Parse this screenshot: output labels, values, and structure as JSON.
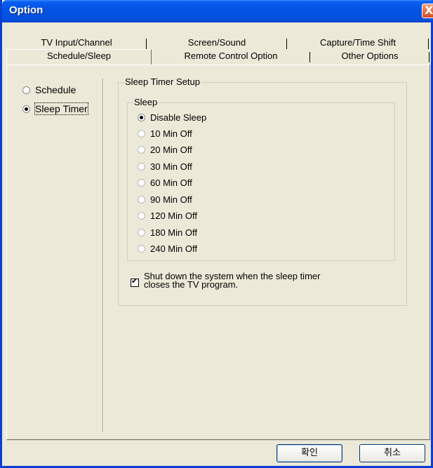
{
  "window": {
    "title": "Option",
    "close_glyph": "X"
  },
  "tabs": {
    "back_row": [
      {
        "label": "TV Input/Channel"
      },
      {
        "label": "Screen/Sound"
      },
      {
        "label": "Capture/Time Shift"
      }
    ],
    "front_row": [
      {
        "label": "Schedule/Sleep",
        "active": true
      },
      {
        "label": "Remote Control Option"
      },
      {
        "label": "Other Options"
      }
    ]
  },
  "nav": {
    "items": [
      {
        "label": "Schedule",
        "checked": false
      },
      {
        "label": "Sleep Timer",
        "checked": true
      }
    ]
  },
  "sleep_timer_setup": {
    "group_title": "Sleep Timer Setup",
    "sleep_group_title": "Sleep",
    "options": [
      {
        "label": "Disable Sleep",
        "checked": true
      },
      {
        "label": "10 Min Off",
        "checked": false
      },
      {
        "label": "20 Min Off",
        "checked": false
      },
      {
        "label": "30 Min Off",
        "checked": false
      },
      {
        "label": "60 Min Off",
        "checked": false
      },
      {
        "label": "90 Min Off",
        "checked": false
      },
      {
        "label": "120 Min Off",
        "checked": false
      },
      {
        "label": "180 Min Off",
        "checked": false
      },
      {
        "label": "240 Min Off",
        "checked": false
      }
    ],
    "shutdown_checkbox": {
      "checked": true,
      "line1": "Shut down the system when the sleep timer",
      "line2": "closes the TV program."
    }
  },
  "buttons": {
    "ok": "확인",
    "cancel": "취소"
  },
  "colors": {
    "titlebar": "#0354e5",
    "window_bg": "#ece9d8",
    "close_button": "#d74a22"
  },
  "icons": {
    "close": "close-icon",
    "check": "checkmark-icon"
  }
}
